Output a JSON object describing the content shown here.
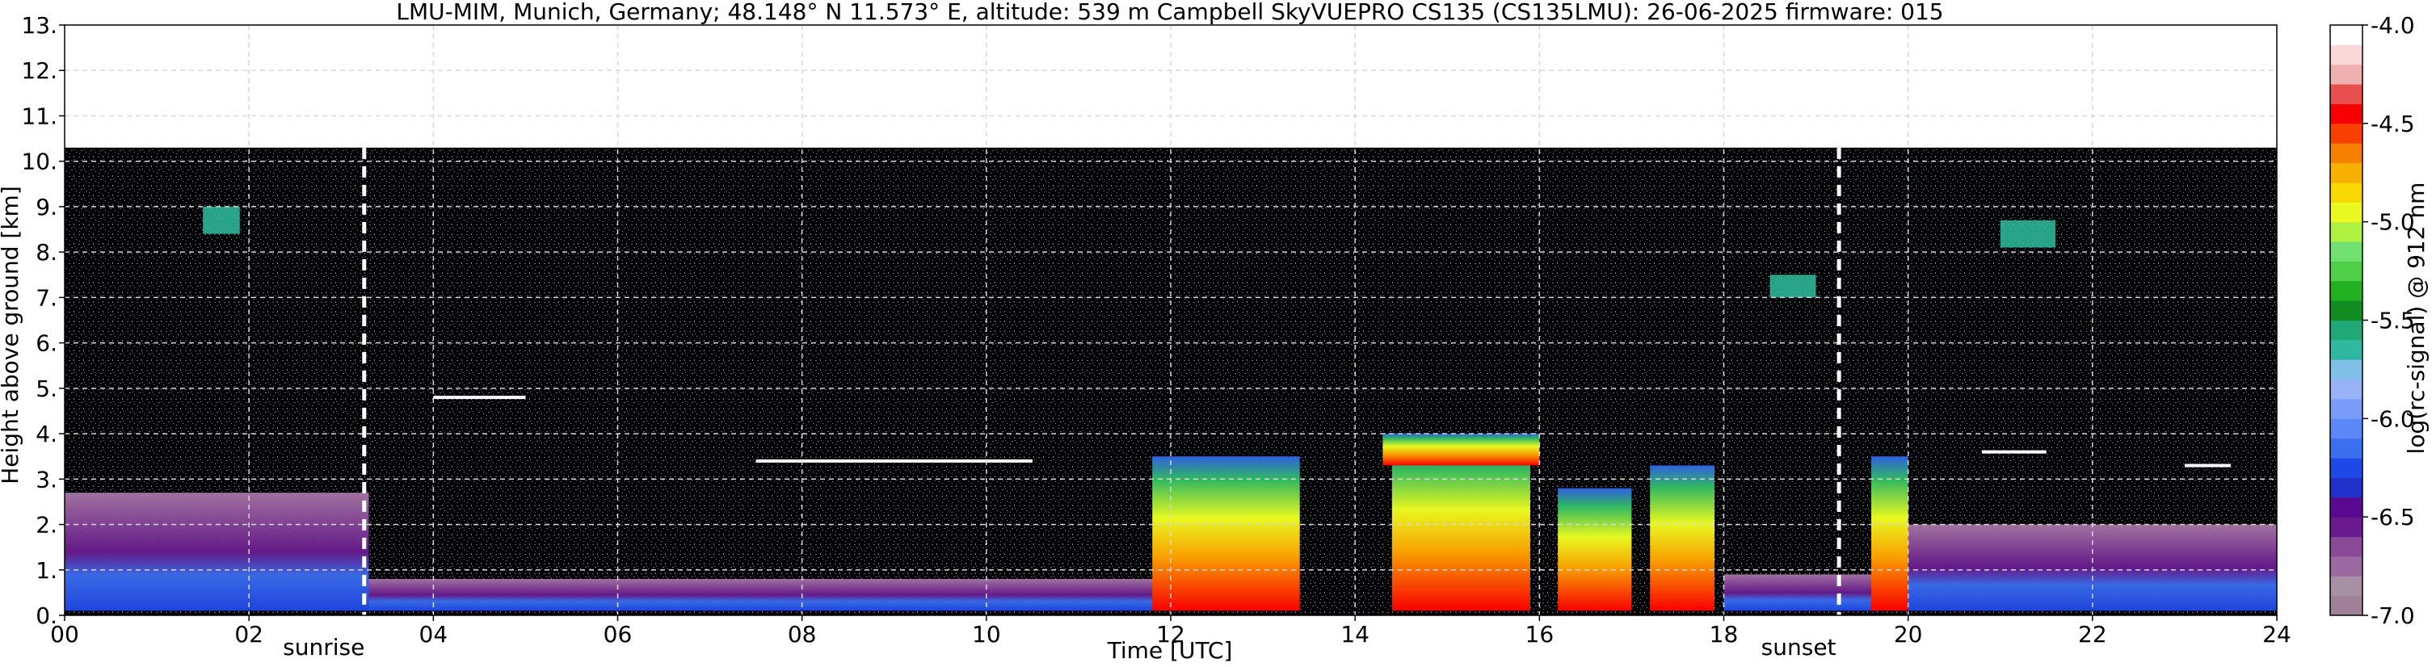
{
  "chart_data": {
    "type": "heatmap",
    "title": "LMU-MIM, Munich, Germany; 48.148° N 11.573° E, altitude: 539 m    Campbell SkyVUEPRO CS135 (CS135LMU): 26-06-2025    firmware: 015",
    "xlabel": "Time [UTC]",
    "ylabel": "Height above ground [km]",
    "xlim": [
      0,
      24
    ],
    "ylim": [
      0,
      13
    ],
    "x_ticks": [
      "00",
      "02",
      "04",
      "06",
      "08",
      "10",
      "12",
      "14",
      "16",
      "18",
      "20",
      "22",
      "24"
    ],
    "x_tick_values": [
      0,
      2,
      4,
      6,
      8,
      10,
      12,
      14,
      16,
      18,
      20,
      22,
      24
    ],
    "y_ticks": [
      "0.",
      "1.",
      "2.",
      "3.",
      "4.",
      "5.",
      "6.",
      "7.",
      "8.",
      "9.",
      "10.",
      "11.",
      "12.",
      "13."
    ],
    "y_tick_values": [
      0,
      1,
      2,
      3,
      4,
      5,
      6,
      7,
      8,
      9,
      10,
      11,
      12,
      13
    ],
    "grid": true,
    "data_top_km": 10.3,
    "events": [
      {
        "label": "sunrise",
        "time": 3.25
      },
      {
        "label": "sunset",
        "time": 19.25
      }
    ],
    "colorbar": {
      "label": "log(rc-signal) @ 912 nm",
      "range": [
        -7.0,
        -4.0
      ],
      "ticks": [
        "-4.0",
        "-4.5",
        "-5.0",
        "-5.5",
        "-6.0",
        "-6.5",
        "-7.0"
      ],
      "tick_values": [
        -4.0,
        -4.5,
        -5.0,
        -5.5,
        -6.0,
        -6.5,
        -7.0
      ],
      "colors": [
        "#a08098",
        "#a890a4",
        "#9c6aa0",
        "#8a4a98",
        "#6a1a8e",
        "#5a0a90",
        "#2030c8",
        "#1f48e8",
        "#3c6ef0",
        "#5a88f8",
        "#7a9cf8",
        "#98b2f8",
        "#80c0e8",
        "#30b8a0",
        "#20a878",
        "#108c20",
        "#20b020",
        "#50d048",
        "#70e070",
        "#b0f040",
        "#e8f820",
        "#f8d800",
        "#f8b000",
        "#f88000",
        "#f84000",
        "#f80000",
        "#e85050",
        "#f0b0b0",
        "#f8d8d8",
        "#ffffff"
      ]
    },
    "features": [
      {
        "kind": "boundary_layer",
        "t0": 0,
        "t1": 3.3,
        "h0": 0.1,
        "h1": 2.7,
        "color": "#a878a8"
      },
      {
        "kind": "boundary_layer",
        "t0": 3.3,
        "t1": 12,
        "h0": 0.1,
        "h1": 0.8,
        "color": "#7a3aa0"
      },
      {
        "kind": "boundary_layer",
        "t0": 18,
        "t1": 19.8,
        "h0": 0.1,
        "h1": 0.9,
        "color": "#7a3aa0"
      },
      {
        "kind": "boundary_layer",
        "t0": 20,
        "t1": 24,
        "h0": 0.1,
        "h1": 2.0,
        "color": "#a078a8"
      },
      {
        "kind": "cloud",
        "t0": 11.8,
        "t1": 13.4,
        "h0": 0.1,
        "h1": 3.5
      },
      {
        "kind": "cloud",
        "t0": 14.4,
        "t1": 15.9,
        "h0": 0.1,
        "h1": 3.8
      },
      {
        "kind": "cloud",
        "t0": 16.2,
        "t1": 17.0,
        "h0": 0.1,
        "h1": 2.8
      },
      {
        "kind": "cloud",
        "t0": 17.2,
        "t1": 17.9,
        "h0": 0.1,
        "h1": 3.3
      },
      {
        "kind": "cloud",
        "t0": 19.6,
        "t1": 20.0,
        "h0": 0.1,
        "h1": 3.5
      },
      {
        "kind": "cloud_layer",
        "t0": 14.3,
        "t1": 16.0,
        "h0": 3.3,
        "h1": 4.0
      },
      {
        "kind": "thin_layer",
        "t0": 4.0,
        "t1": 5.0,
        "h": 4.8
      },
      {
        "kind": "thin_layer",
        "t0": 7.5,
        "t1": 10.5,
        "h": 3.4
      },
      {
        "kind": "thin_layer",
        "t0": 20.8,
        "t1": 21.5,
        "h": 3.6
      },
      {
        "kind": "thin_layer",
        "t0": 23.0,
        "t1": 23.5,
        "h": 3.3
      },
      {
        "kind": "cirrus",
        "t0": 1.5,
        "t1": 1.9,
        "h0": 8.4,
        "h1": 9.0
      },
      {
        "kind": "cirrus",
        "t0": 21.0,
        "t1": 21.6,
        "h0": 8.1,
        "h1": 8.7
      },
      {
        "kind": "cirrus",
        "t0": 18.5,
        "t1": 19.0,
        "h0": 7.0,
        "h1": 7.5
      }
    ]
  }
}
